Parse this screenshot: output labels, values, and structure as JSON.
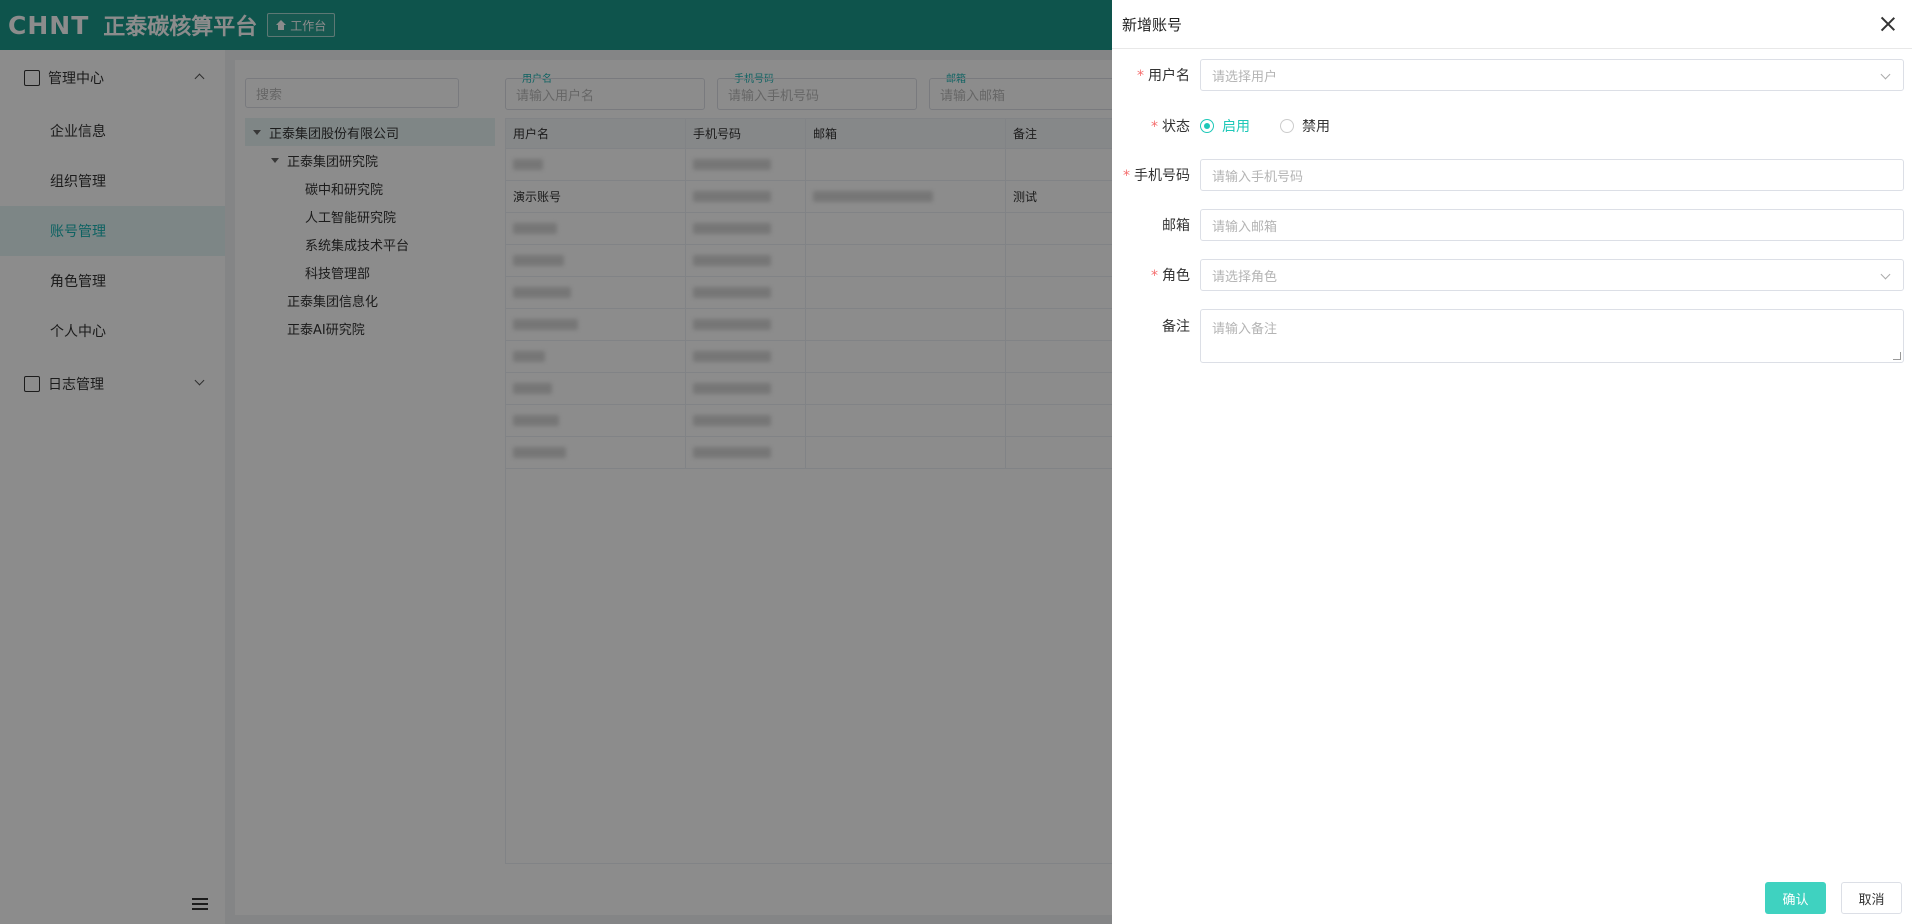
{
  "header": {
    "logo": "CHNT",
    "title": "正泰碳核算平台",
    "workbench_label": "工作台"
  },
  "sidebar": {
    "groups": [
      {
        "label": "管理中心",
        "icon": "manage-icon",
        "expanded": true
      },
      {
        "label": "日志管理",
        "icon": "log-icon",
        "expanded": false
      }
    ],
    "items": [
      {
        "label": "企业信息"
      },
      {
        "label": "组织管理"
      },
      {
        "label": "账号管理",
        "active": true
      },
      {
        "label": "角色管理"
      },
      {
        "label": "个人中心"
      }
    ]
  },
  "main": {
    "search_placeholder": "搜索",
    "tree": [
      {
        "label": "正泰集团股份有限公司"
      },
      {
        "label": "正泰集团研究院"
      },
      {
        "label": "碳中和研究院"
      },
      {
        "label": "人工智能研究院"
      },
      {
        "label": "系统集成技术平台"
      },
      {
        "label": "科技管理部"
      },
      {
        "label": "正泰集团信息化"
      },
      {
        "label": "正泰AI研究院"
      }
    ],
    "filters": [
      {
        "label": "用户名",
        "placeholder": "请输入用户名"
      },
      {
        "label": "手机号码",
        "placeholder": "请输入手机号码"
      },
      {
        "label": "邮箱",
        "placeholder": "请输入邮箱"
      }
    ],
    "table": {
      "columns": [
        "用户名",
        "手机号码",
        "邮箱",
        "备注"
      ],
      "visible_row": {
        "username": "演示账号",
        "remark": "测试"
      }
    }
  },
  "drawer": {
    "title": "新增账号",
    "fields": {
      "username": {
        "label": "用户名",
        "placeholder": "请选择用户"
      },
      "status": {
        "label": "状态",
        "options": [
          "启用",
          "禁用"
        ],
        "selected": "启用"
      },
      "phone": {
        "label": "手机号码",
        "placeholder": "请输入手机号码"
      },
      "email": {
        "label": "邮箱",
        "placeholder": "请输入邮箱"
      },
      "role": {
        "label": "角色",
        "placeholder": "请选择角色"
      },
      "remark": {
        "label": "备注",
        "placeholder": "请输入备注"
      }
    },
    "confirm_label": "确认",
    "cancel_label": "取消"
  },
  "colors": {
    "header_bg": "#1a9a8a",
    "accent": "#1ec8b8",
    "confirm_bg": "#3fd2c0",
    "required": "#f56c6c"
  }
}
